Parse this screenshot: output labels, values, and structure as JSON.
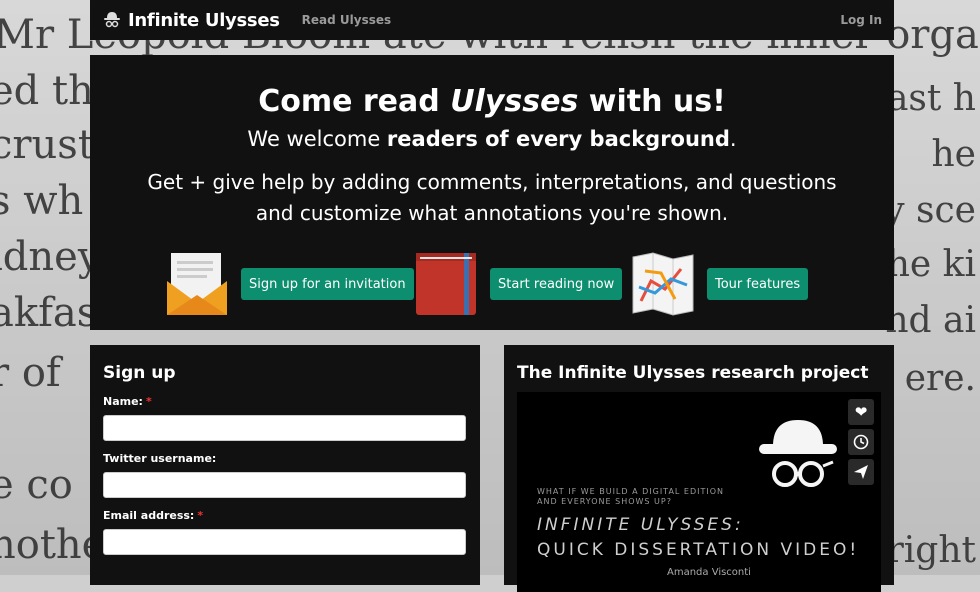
{
  "background_text": {
    "lines": [
      "Mr Leopold Bloom ate with relish the inner organs",
      "ed th",
      "crusto",
      "s wh",
      "idney",
      "akfas",
      "r of",
      "e co",
      "nothe"
    ],
    "right": [
      "oast h",
      "he",
      "y sce",
      "he ki",
      "nd ai",
      "ere.",
      "right"
    ]
  },
  "navbar": {
    "brand": "Infinite Ulysses",
    "read_link": "Read Ulysses",
    "login_link": "Log In"
  },
  "hero": {
    "title_prefix": "Come read ",
    "title_em": "Ulysses",
    "title_suffix": " with us!",
    "line2_prefix": "We welcome ",
    "line2_bold": "readers of every background",
    "line2_suffix": ".",
    "line3a": "Get + give help by adding comments, interpretations, and questions",
    "line3b": "and customize what annotations you're shown.",
    "buttons": {
      "signup": "Sign up for an invitation",
      "read": "Start reading now",
      "tour": "Tour features"
    }
  },
  "signup": {
    "title": "Sign up",
    "fields": {
      "name": "Name:",
      "twitter": "Twitter username:",
      "email": "Email address:"
    },
    "required_mark": "*"
  },
  "research": {
    "title": "The Infinite Ulysses research project",
    "video": {
      "small_line1": "WHAT IF WE BUILD A DIGITAL EDITION",
      "small_line2": "AND EVERYONE SHOWS UP?",
      "big_line1": "INFINITE ULYSSES:",
      "big_line2": "QUICK DISSERTATION VIDEO!",
      "author": "Amanda Visconti"
    }
  },
  "colors": {
    "panel": "#111111",
    "accent_button": "#0d8f6f",
    "required": "#ee3333"
  },
  "icons": [
    "spy-hat-logo-icon",
    "envelope-icon",
    "book-icon",
    "map-icon",
    "heart-icon",
    "clock-icon",
    "send-icon",
    "spy-hat-icon"
  ]
}
